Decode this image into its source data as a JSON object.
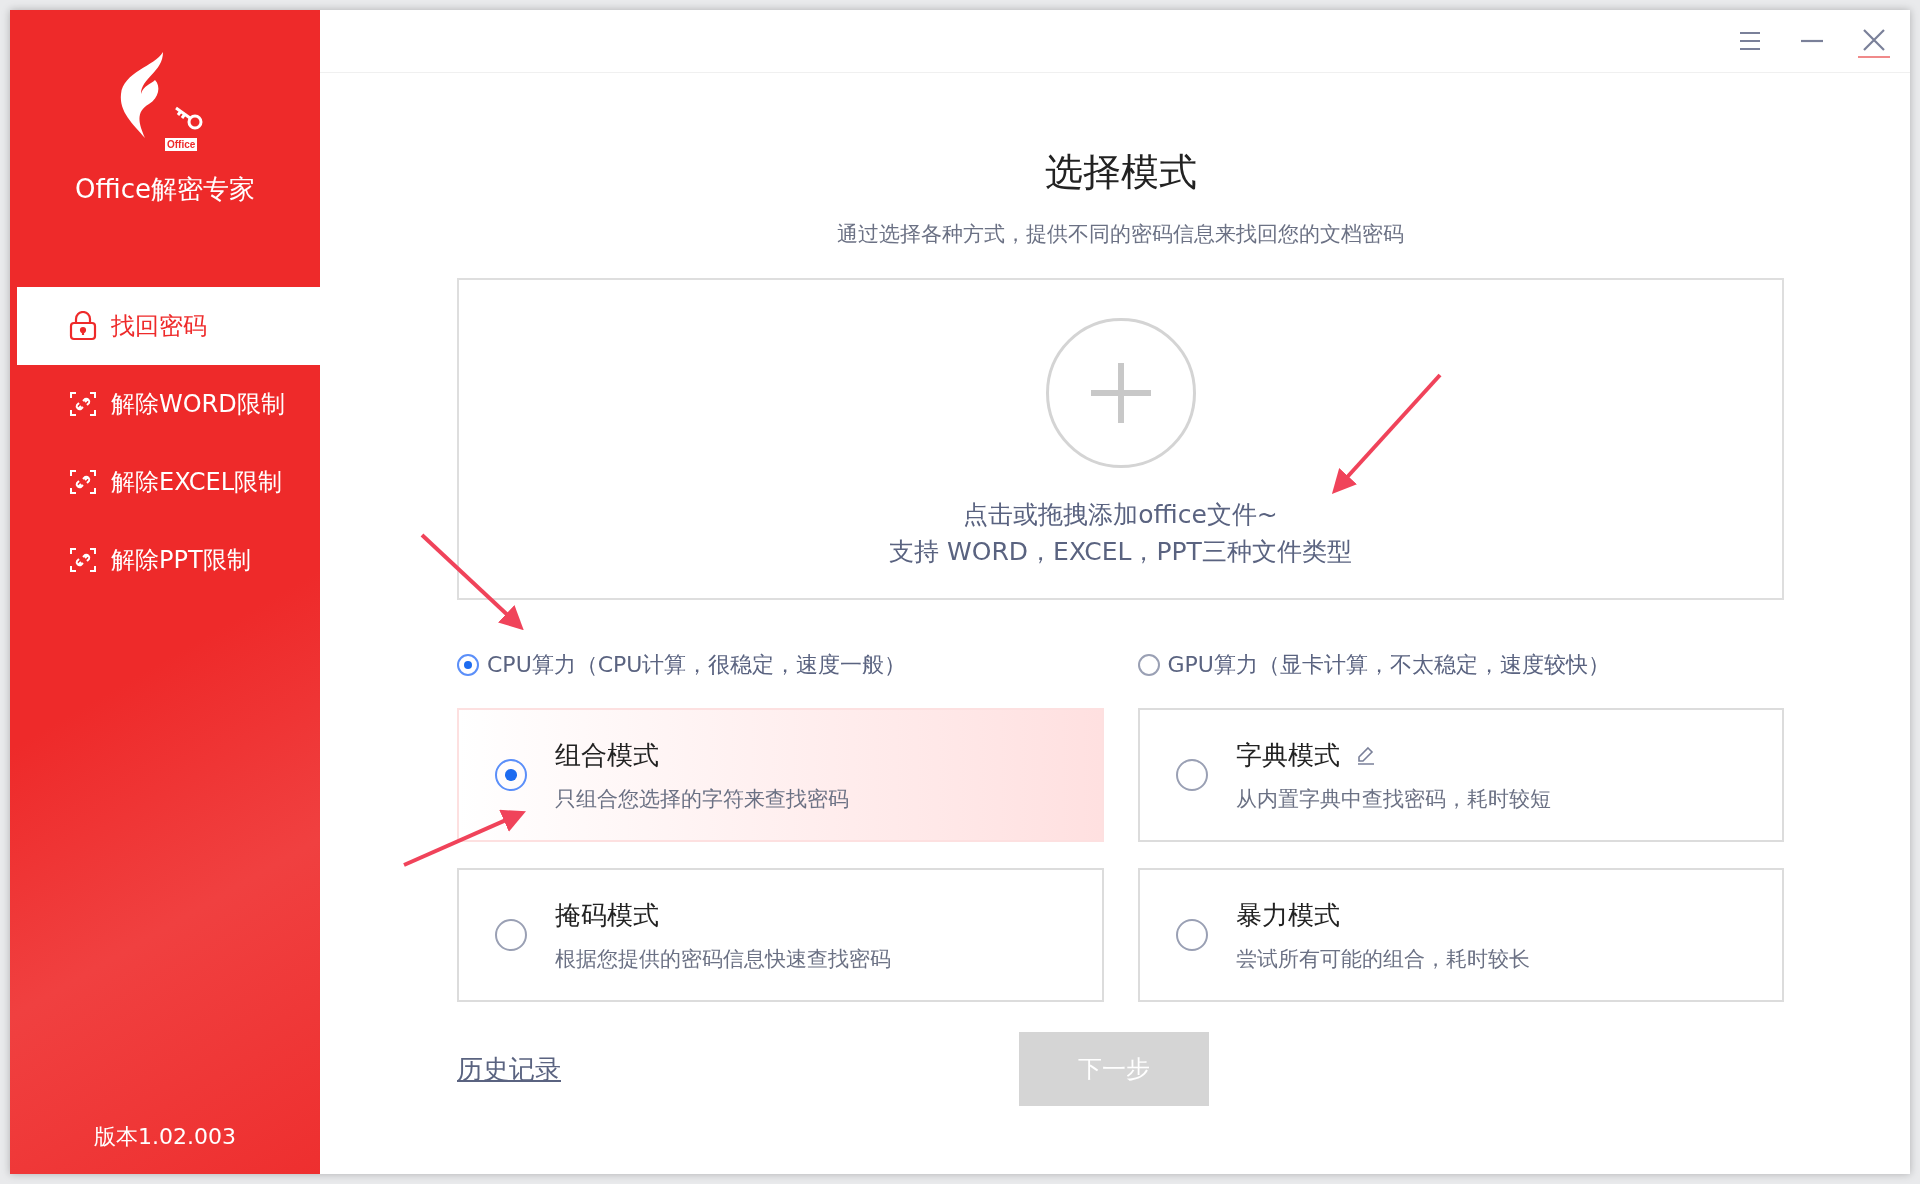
{
  "app": {
    "logo_badge": "Office",
    "name": "Office解密专家",
    "version": "版本1.02.003"
  },
  "nav": [
    {
      "label": "找回密码",
      "kind": "lock",
      "selected": true
    },
    {
      "label": "解除WORD限制",
      "kind": "unlink",
      "selected": false
    },
    {
      "label": "解除EXCEL限制",
      "kind": "unlink",
      "selected": false
    },
    {
      "label": "解除PPT限制",
      "kind": "unlink",
      "selected": false
    }
  ],
  "header": {
    "title": "选择模式",
    "subtitle": "通过选择各种方式，提供不同的密码信息来找回您的文档密码"
  },
  "dropzone": {
    "line1": "点击或拖拽添加office文件~",
    "line2": "支持 WORD，EXCEL，PPT三种文件类型"
  },
  "compute": [
    {
      "label": "CPU算力（CPU计算，很稳定，速度一般）",
      "selected": true
    },
    {
      "label": "GPU算力（显卡计算，不太稳定，速度较快）",
      "selected": false
    }
  ],
  "modes": [
    {
      "title": "组合模式",
      "description": "只组合您选择的字符来查找密码",
      "selected": true,
      "editable": false
    },
    {
      "title": "字典模式",
      "description": "从内置字典中查找密码，耗时较短",
      "selected": false,
      "editable": true
    },
    {
      "title": "掩码模式",
      "description": "根据您提供的密码信息快速查找密码",
      "selected": false,
      "editable": false
    },
    {
      "title": "暴力模式",
      "description": "尝试所有可能的组合，耗时较长",
      "selected": false,
      "editable": false
    }
  ],
  "history_link": "历史记录",
  "next_button": {
    "label": "下一步",
    "disabled": true
  }
}
